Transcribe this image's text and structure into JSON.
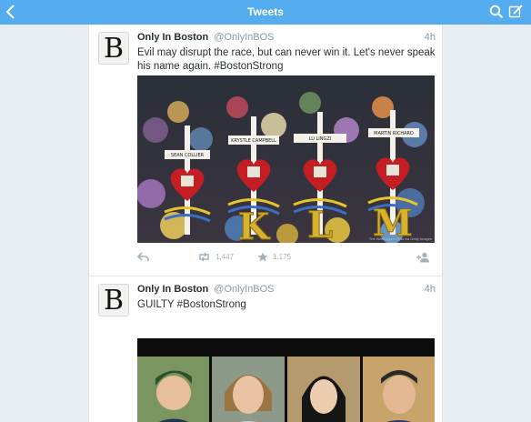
{
  "header": {
    "title": "Tweets"
  },
  "tweets": [
    {
      "avatar_letter": "B",
      "name": "Only In Boston",
      "handle": "@OnlyInBOS",
      "time": "4h",
      "text": "Evil may disrupt the race, but can never win it. Let's never speak his name again. #BostonStrong",
      "photo": {
        "credit": "The Washington Post via Getty Images",
        "cross_names": [
          "SEAN COLLIER",
          "KRYSTLE CAMPBELL",
          "LU LINGZI",
          "MARTIN RICHARD"
        ],
        "letters": [
          "K",
          "L",
          "M"
        ]
      },
      "retweets": "1,447",
      "favorites": "1,175"
    },
    {
      "avatar_letter": "B",
      "name": "Only In Boston",
      "handle": "@OnlyInBOS",
      "time": "4h",
      "text": "GUILTY #BostonStrong"
    }
  ],
  "colors": {
    "accent": "#55acee",
    "icon_grey": "#a5b1ba",
    "text": "#292f33",
    "meta": "#8899a6"
  },
  "icons": [
    "back-icon",
    "search-icon",
    "compose-icon",
    "reply-icon",
    "retweet-icon",
    "favorite-icon",
    "follow-icon"
  ]
}
